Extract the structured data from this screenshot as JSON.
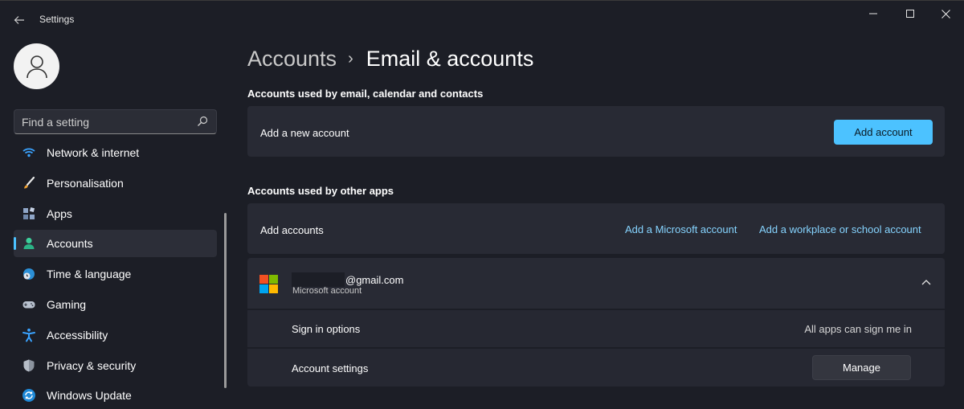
{
  "titlebar": {
    "title": "Settings"
  },
  "search": {
    "placeholder": "Find a setting"
  },
  "sidebar": {
    "items": [
      {
        "label": "Network & internet",
        "icon": "wifi-icon"
      },
      {
        "label": "Personalisation",
        "icon": "brush-icon"
      },
      {
        "label": "Apps",
        "icon": "apps-icon"
      },
      {
        "label": "Accounts",
        "icon": "person-icon",
        "selected": true
      },
      {
        "label": "Time & language",
        "icon": "globe-clock-icon"
      },
      {
        "label": "Gaming",
        "icon": "gamepad-icon"
      },
      {
        "label": "Accessibility",
        "icon": "accessibility-icon"
      },
      {
        "label": "Privacy & security",
        "icon": "shield-icon"
      },
      {
        "label": "Windows Update",
        "icon": "sync-icon"
      }
    ]
  },
  "breadcrumb": {
    "parent": "Accounts",
    "separator": "›",
    "current": "Email & accounts"
  },
  "sections": {
    "email": {
      "heading": "Accounts used by email, calendar and contacts",
      "row_label": "Add a new account",
      "button": "Add account"
    },
    "other": {
      "heading": "Accounts used by other apps",
      "row_label": "Add accounts",
      "link_microsoft": "Add a Microsoft account",
      "link_work": "Add a workplace or school account"
    }
  },
  "account": {
    "email_suffix": "@gmail.com",
    "type": "Microsoft account",
    "sign_in_label": "Sign in options",
    "sign_in_value": "All apps can sign me in",
    "settings_label": "Account settings",
    "manage_button": "Manage"
  },
  "colors": {
    "accent": "#4cc2ff",
    "background": "#1c1e26",
    "card": "#282a34"
  }
}
